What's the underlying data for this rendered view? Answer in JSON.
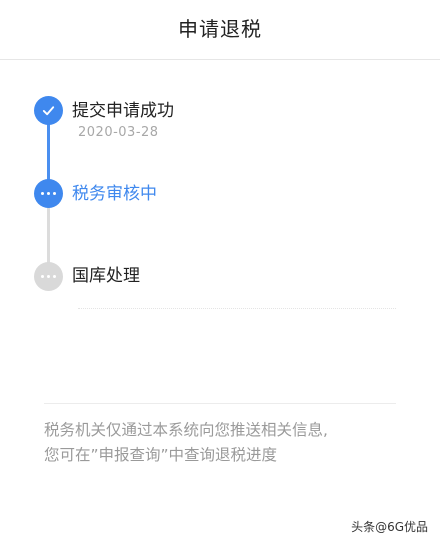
{
  "header": {
    "title": "申请退税"
  },
  "timeline": {
    "steps": [
      {
        "label": "提交申请成功",
        "date": "2020-03-28",
        "status": "done"
      },
      {
        "label": "税务审核中",
        "status": "active"
      },
      {
        "label": "国库处理",
        "status": "pending"
      }
    ]
  },
  "notice": {
    "line1": "税务机关仅通过本系统向您推送相关信息,",
    "line2": "您可在”申报查询”中查询退税进度"
  },
  "watermark": {
    "text": "头条@6G优品"
  },
  "colors": {
    "accent": "#3f88ee",
    "pending": "#d9d9d9",
    "muted_text": "#9a9a9a"
  }
}
